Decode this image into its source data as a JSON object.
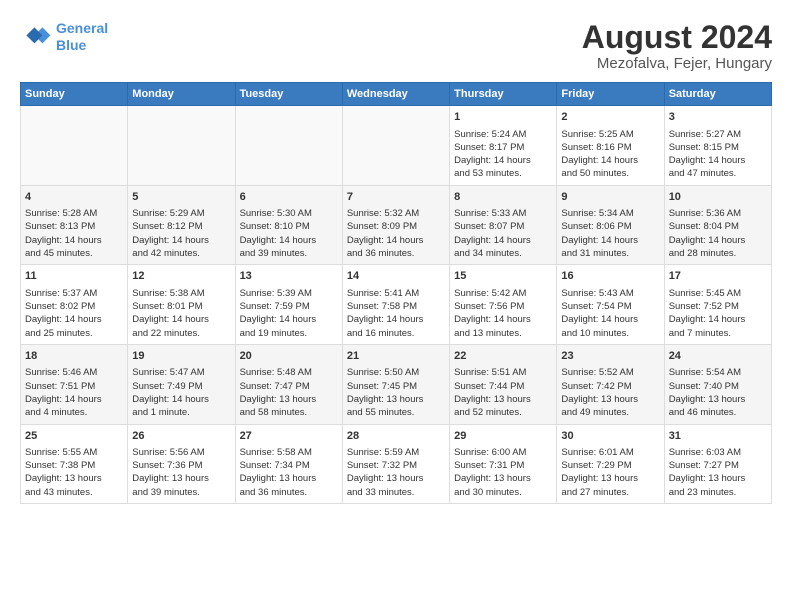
{
  "header": {
    "logo_line1": "General",
    "logo_line2": "Blue",
    "title": "August 2024",
    "subtitle": "Mezofalva, Fejer, Hungary"
  },
  "days_of_week": [
    "Sunday",
    "Monday",
    "Tuesday",
    "Wednesday",
    "Thursday",
    "Friday",
    "Saturday"
  ],
  "weeks": [
    {
      "cells": [
        {
          "day": "",
          "content": ""
        },
        {
          "day": "",
          "content": ""
        },
        {
          "day": "",
          "content": ""
        },
        {
          "day": "",
          "content": ""
        },
        {
          "day": "1",
          "content": "Sunrise: 5:24 AM\nSunset: 8:17 PM\nDaylight: 14 hours\nand 53 minutes."
        },
        {
          "day": "2",
          "content": "Sunrise: 5:25 AM\nSunset: 8:16 PM\nDaylight: 14 hours\nand 50 minutes."
        },
        {
          "day": "3",
          "content": "Sunrise: 5:27 AM\nSunset: 8:15 PM\nDaylight: 14 hours\nand 47 minutes."
        }
      ]
    },
    {
      "cells": [
        {
          "day": "4",
          "content": "Sunrise: 5:28 AM\nSunset: 8:13 PM\nDaylight: 14 hours\nand 45 minutes."
        },
        {
          "day": "5",
          "content": "Sunrise: 5:29 AM\nSunset: 8:12 PM\nDaylight: 14 hours\nand 42 minutes."
        },
        {
          "day": "6",
          "content": "Sunrise: 5:30 AM\nSunset: 8:10 PM\nDaylight: 14 hours\nand 39 minutes."
        },
        {
          "day": "7",
          "content": "Sunrise: 5:32 AM\nSunset: 8:09 PM\nDaylight: 14 hours\nand 36 minutes."
        },
        {
          "day": "8",
          "content": "Sunrise: 5:33 AM\nSunset: 8:07 PM\nDaylight: 14 hours\nand 34 minutes."
        },
        {
          "day": "9",
          "content": "Sunrise: 5:34 AM\nSunset: 8:06 PM\nDaylight: 14 hours\nand 31 minutes."
        },
        {
          "day": "10",
          "content": "Sunrise: 5:36 AM\nSunset: 8:04 PM\nDaylight: 14 hours\nand 28 minutes."
        }
      ]
    },
    {
      "cells": [
        {
          "day": "11",
          "content": "Sunrise: 5:37 AM\nSunset: 8:02 PM\nDaylight: 14 hours\nand 25 minutes."
        },
        {
          "day": "12",
          "content": "Sunrise: 5:38 AM\nSunset: 8:01 PM\nDaylight: 14 hours\nand 22 minutes."
        },
        {
          "day": "13",
          "content": "Sunrise: 5:39 AM\nSunset: 7:59 PM\nDaylight: 14 hours\nand 19 minutes."
        },
        {
          "day": "14",
          "content": "Sunrise: 5:41 AM\nSunset: 7:58 PM\nDaylight: 14 hours\nand 16 minutes."
        },
        {
          "day": "15",
          "content": "Sunrise: 5:42 AM\nSunset: 7:56 PM\nDaylight: 14 hours\nand 13 minutes."
        },
        {
          "day": "16",
          "content": "Sunrise: 5:43 AM\nSunset: 7:54 PM\nDaylight: 14 hours\nand 10 minutes."
        },
        {
          "day": "17",
          "content": "Sunrise: 5:45 AM\nSunset: 7:52 PM\nDaylight: 14 hours\nand 7 minutes."
        }
      ]
    },
    {
      "cells": [
        {
          "day": "18",
          "content": "Sunrise: 5:46 AM\nSunset: 7:51 PM\nDaylight: 14 hours\nand 4 minutes."
        },
        {
          "day": "19",
          "content": "Sunrise: 5:47 AM\nSunset: 7:49 PM\nDaylight: 14 hours\nand 1 minute."
        },
        {
          "day": "20",
          "content": "Sunrise: 5:48 AM\nSunset: 7:47 PM\nDaylight: 13 hours\nand 58 minutes."
        },
        {
          "day": "21",
          "content": "Sunrise: 5:50 AM\nSunset: 7:45 PM\nDaylight: 13 hours\nand 55 minutes."
        },
        {
          "day": "22",
          "content": "Sunrise: 5:51 AM\nSunset: 7:44 PM\nDaylight: 13 hours\nand 52 minutes."
        },
        {
          "day": "23",
          "content": "Sunrise: 5:52 AM\nSunset: 7:42 PM\nDaylight: 13 hours\nand 49 minutes."
        },
        {
          "day": "24",
          "content": "Sunrise: 5:54 AM\nSunset: 7:40 PM\nDaylight: 13 hours\nand 46 minutes."
        }
      ]
    },
    {
      "cells": [
        {
          "day": "25",
          "content": "Sunrise: 5:55 AM\nSunset: 7:38 PM\nDaylight: 13 hours\nand 43 minutes."
        },
        {
          "day": "26",
          "content": "Sunrise: 5:56 AM\nSunset: 7:36 PM\nDaylight: 13 hours\nand 39 minutes."
        },
        {
          "day": "27",
          "content": "Sunrise: 5:58 AM\nSunset: 7:34 PM\nDaylight: 13 hours\nand 36 minutes."
        },
        {
          "day": "28",
          "content": "Sunrise: 5:59 AM\nSunset: 7:32 PM\nDaylight: 13 hours\nand 33 minutes."
        },
        {
          "day": "29",
          "content": "Sunrise: 6:00 AM\nSunset: 7:31 PM\nDaylight: 13 hours\nand 30 minutes."
        },
        {
          "day": "30",
          "content": "Sunrise: 6:01 AM\nSunset: 7:29 PM\nDaylight: 13 hours\nand 27 minutes."
        },
        {
          "day": "31",
          "content": "Sunrise: 6:03 AM\nSunset: 7:27 PM\nDaylight: 13 hours\nand 23 minutes."
        }
      ]
    }
  ]
}
